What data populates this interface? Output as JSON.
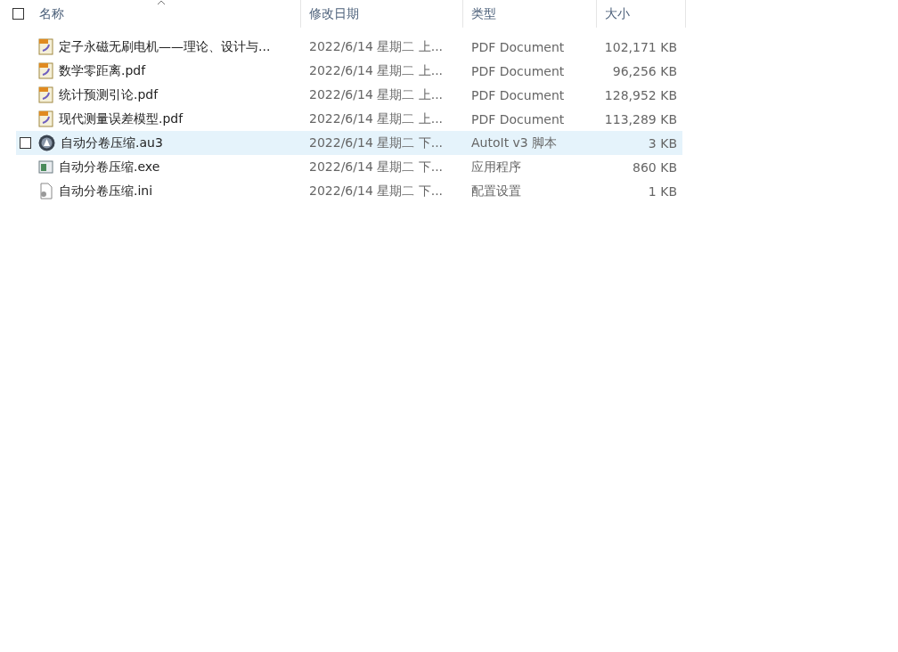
{
  "header": {
    "checked": false,
    "columns": [
      {
        "label": "名称",
        "sorted": true
      },
      {
        "label": "修改日期",
        "sorted": false
      },
      {
        "label": "类型",
        "sorted": false
      },
      {
        "label": "大小",
        "sorted": false
      }
    ]
  },
  "rows": [
    {
      "kind": "pdf",
      "name": "定子永磁无刷电机——理论、设计与...",
      "date": "2022/6/14 星期二 上...",
      "type": "PDF Document",
      "size": "102,171 KB",
      "hovered": false
    },
    {
      "kind": "pdf",
      "name": "数学零距离.pdf",
      "date": "2022/6/14 星期二 上...",
      "type": "PDF Document",
      "size": "96,256 KB",
      "hovered": false
    },
    {
      "kind": "pdf",
      "name": "统计预测引论.pdf",
      "date": "2022/6/14 星期二 上...",
      "type": "PDF Document",
      "size": "128,952 KB",
      "hovered": false
    },
    {
      "kind": "pdf",
      "name": "现代测量误差模型.pdf",
      "date": "2022/6/14 星期二 上...",
      "type": "PDF Document",
      "size": "113,289 KB",
      "hovered": false
    },
    {
      "kind": "script",
      "name": "自动分卷压缩.au3",
      "date": "2022/6/14 星期二 下...",
      "type": "AutoIt v3 脚本",
      "size": "3 KB",
      "hovered": true
    },
    {
      "kind": "exe",
      "name": "自动分卷压缩.exe",
      "date": "2022/6/14 星期二 下...",
      "type": "应用程序",
      "size": "860 KB",
      "hovered": false
    },
    {
      "kind": "ini",
      "name": "自动分卷压缩.ini",
      "date": "2022/6/14 星期二 下...",
      "type": "配置设置",
      "size": "1 KB",
      "hovered": false
    }
  ]
}
